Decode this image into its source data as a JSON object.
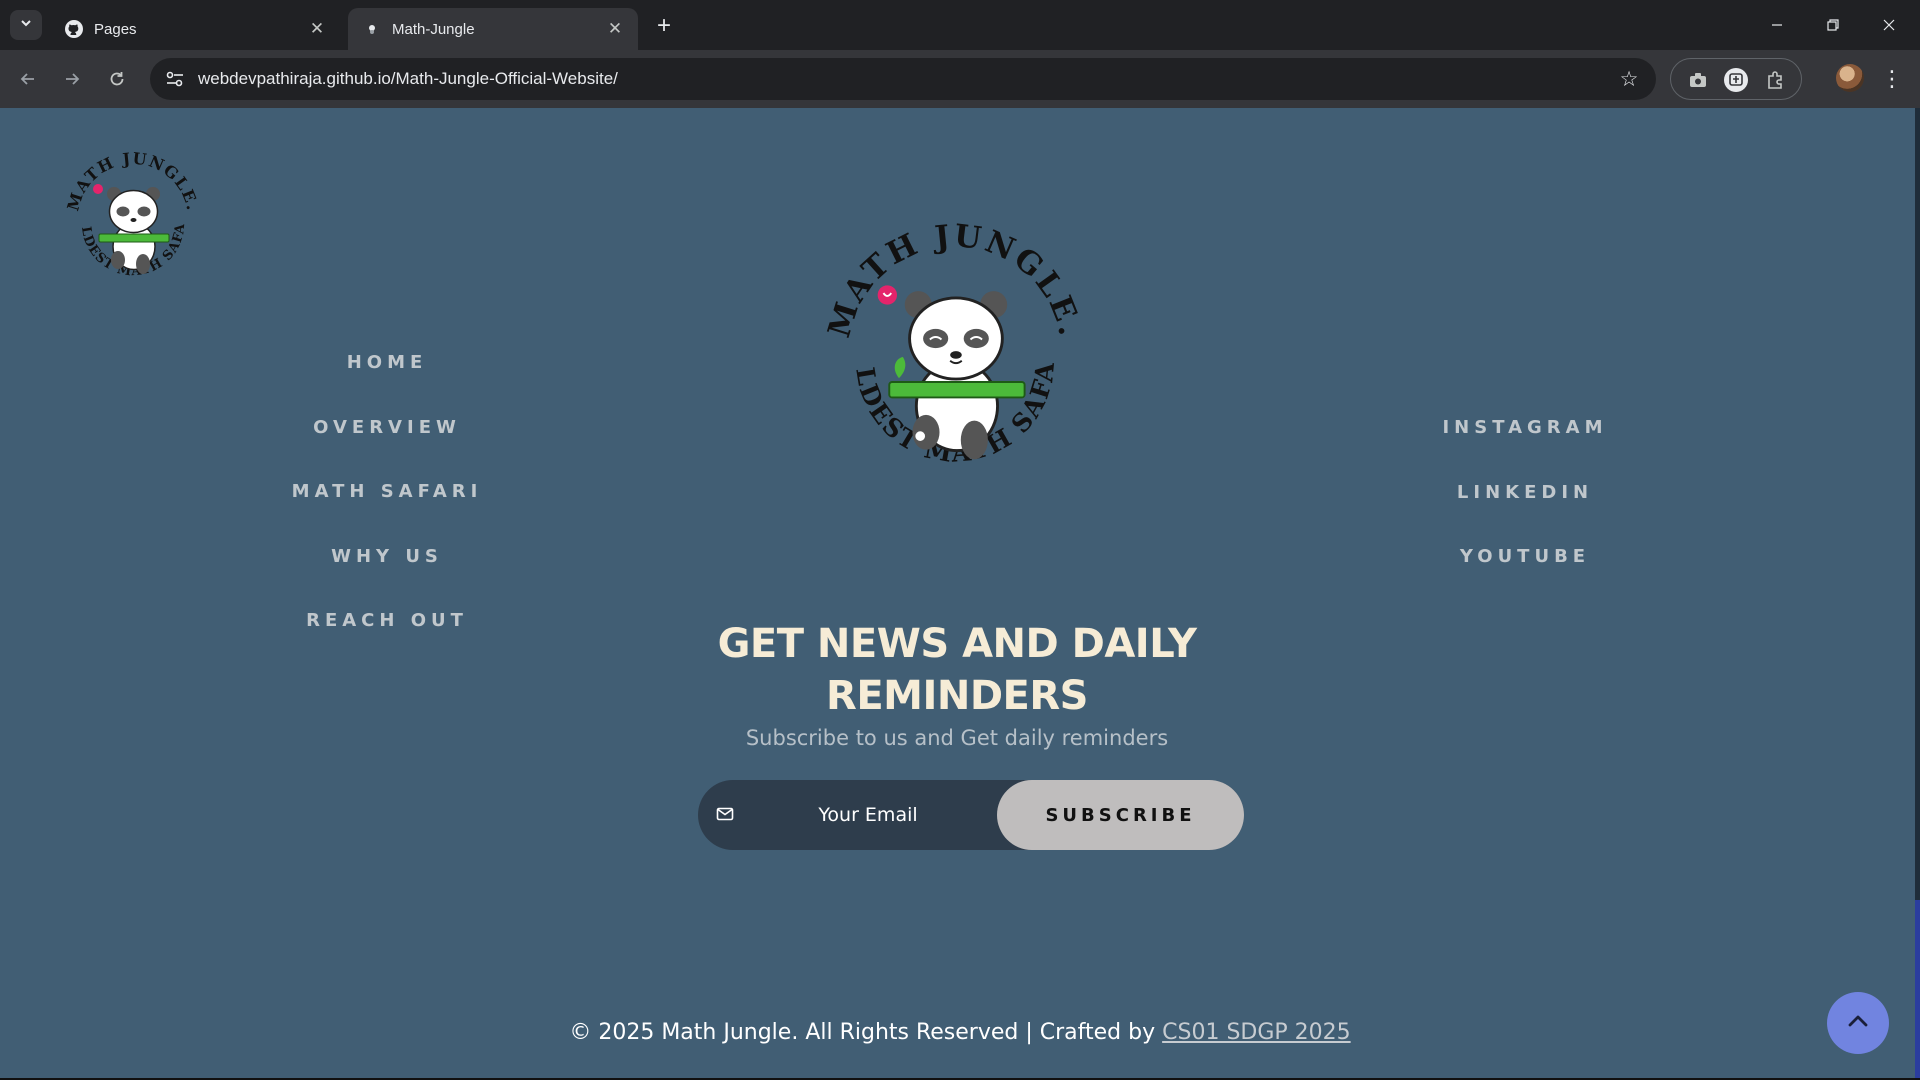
{
  "browser": {
    "tabs": [
      {
        "title": "Pages",
        "favicon": "github-icon"
      },
      {
        "title": "Math-Jungle",
        "favicon": "panda-favicon"
      }
    ],
    "url": "webdevpathiraja.github.io/Math-Jungle-Official-Website/"
  },
  "logo": {
    "arc_top": "MATH JUNGLE.",
    "arc_bottom": "WILDEST MATH SAFARI"
  },
  "nav": {
    "left": [
      "HOME",
      "OVERVIEW",
      "MATH SAFARI",
      "WHY US",
      "REACH OUT"
    ],
    "right": [
      "INSTAGRAM",
      "LINKEDIN",
      "YOUTUBE"
    ]
  },
  "newsletter": {
    "title_line1": "GET NEWS AND DAILY",
    "title_line2": "REMINDERS",
    "subtitle": "Subscribe to us and Get daily reminders",
    "email_placeholder": "Your Email",
    "button": "SUBSCRIBE"
  },
  "footer": {
    "text": "© 2025 Math Jungle. All Rights Reserved | Crafted by",
    "link": "CS01 SDGP 2025"
  },
  "colors": {
    "page_bg": "#415e74",
    "heading": "#f6ecd6",
    "nav_link": "#c0c7cc",
    "scroll_top_btn": "#7184e0"
  }
}
